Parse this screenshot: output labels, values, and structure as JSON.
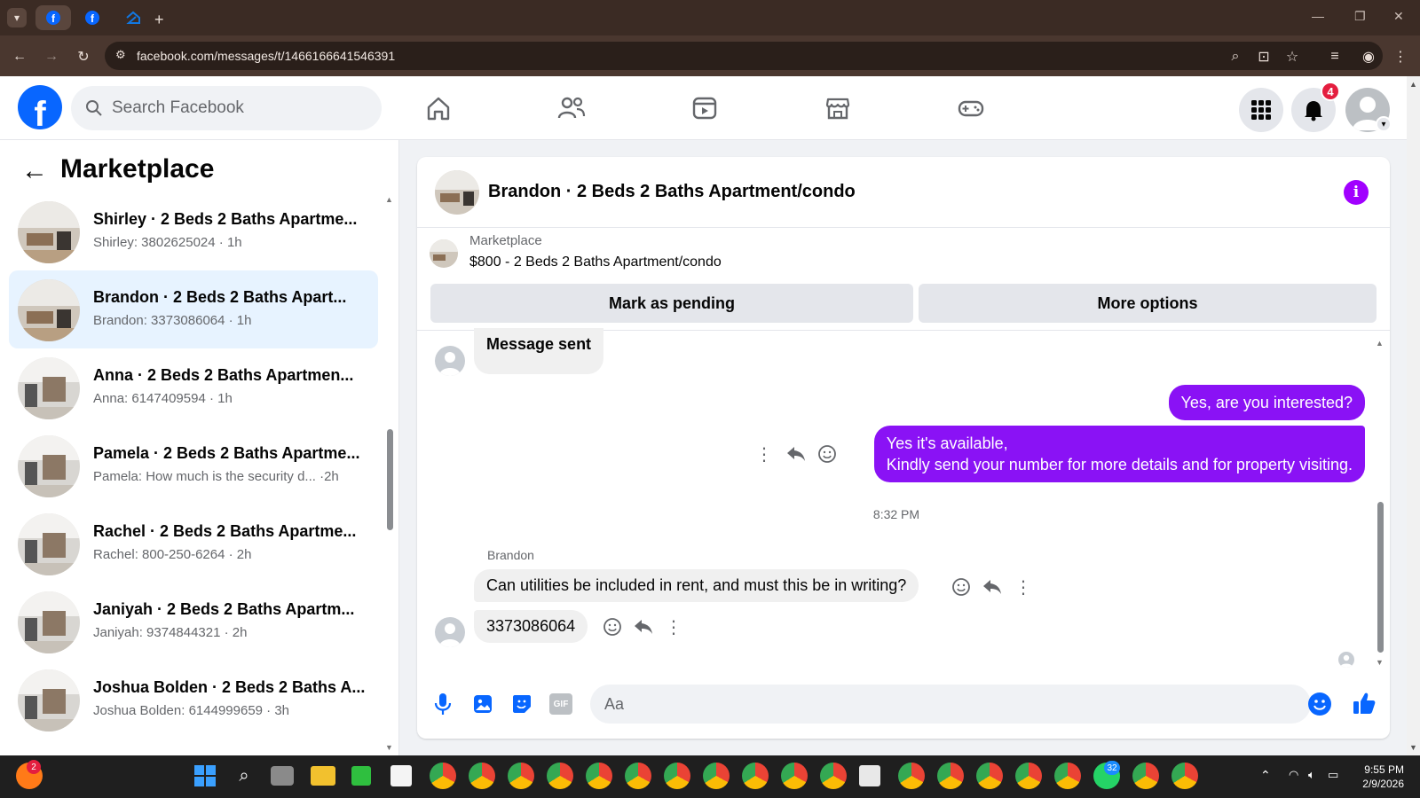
{
  "browser": {
    "url": "facebook.com/messages/t/1466166641546391"
  },
  "header": {
    "search_placeholder": "Search Facebook",
    "notification_count": "4"
  },
  "sidebar": {
    "title": "Marketplace",
    "conversations": [
      {
        "title": "Shirley · 2 Beds 2 Baths Apartme...",
        "sub": "Shirley: 3802625024 · 1h"
      },
      {
        "title": "Brandon · 2 Beds 2 Baths Apart...",
        "sub": "Brandon: 3373086064 · 1h"
      },
      {
        "title": "Anna · 2 Beds 2 Baths Apartmen...",
        "sub": "Anna: 6147409594 · 1h"
      },
      {
        "title": "Pamela · 2 Beds 2 Baths Apartme...",
        "sub": "Pamela: How much is the security d... ·2h"
      },
      {
        "title": "Rachel · 2 Beds 2 Baths Apartme...",
        "sub": "Rachel: 800-250-6264 · 2h"
      },
      {
        "title": "Janiyah · 2 Beds 2 Baths Apartm...",
        "sub": "Janiyah: 9374844321 · 2h"
      },
      {
        "title": "Joshua Bolden · 2 Beds 2 Baths A...",
        "sub": "Joshua Bolden: 6144999659 · 3h"
      }
    ]
  },
  "chat": {
    "title": "Brandon · 2 Beds 2 Baths Apartment/condo",
    "listing_source": "Marketplace",
    "listing_text": "$800 - 2 Beds 2 Baths Apartment/condo",
    "mark_pending": "Mark as pending",
    "more_options": "More options",
    "messages": {
      "m1": "Message sent",
      "m2": "Yes, are you interested?",
      "m3_line1": "Yes it's available,",
      "m3_line2": "Kindly send your number for more details and for property visiting.",
      "time": "8:32 PM",
      "sender": "Brandon",
      "m4": "Can utilities be included in rent, and must this be in writing?",
      "m5": "3373086064"
    },
    "composer_placeholder": "Aa"
  },
  "taskbar": {
    "time": "9:55 PM",
    "date": "2/9/2026",
    "whatsapp_badge": "32",
    "firefox_badge": "2"
  },
  "colors": {
    "fb_blue": "#0866ff",
    "messenger_purple": "#8a12f5",
    "active_conv_bg": "#e7f3ff"
  }
}
